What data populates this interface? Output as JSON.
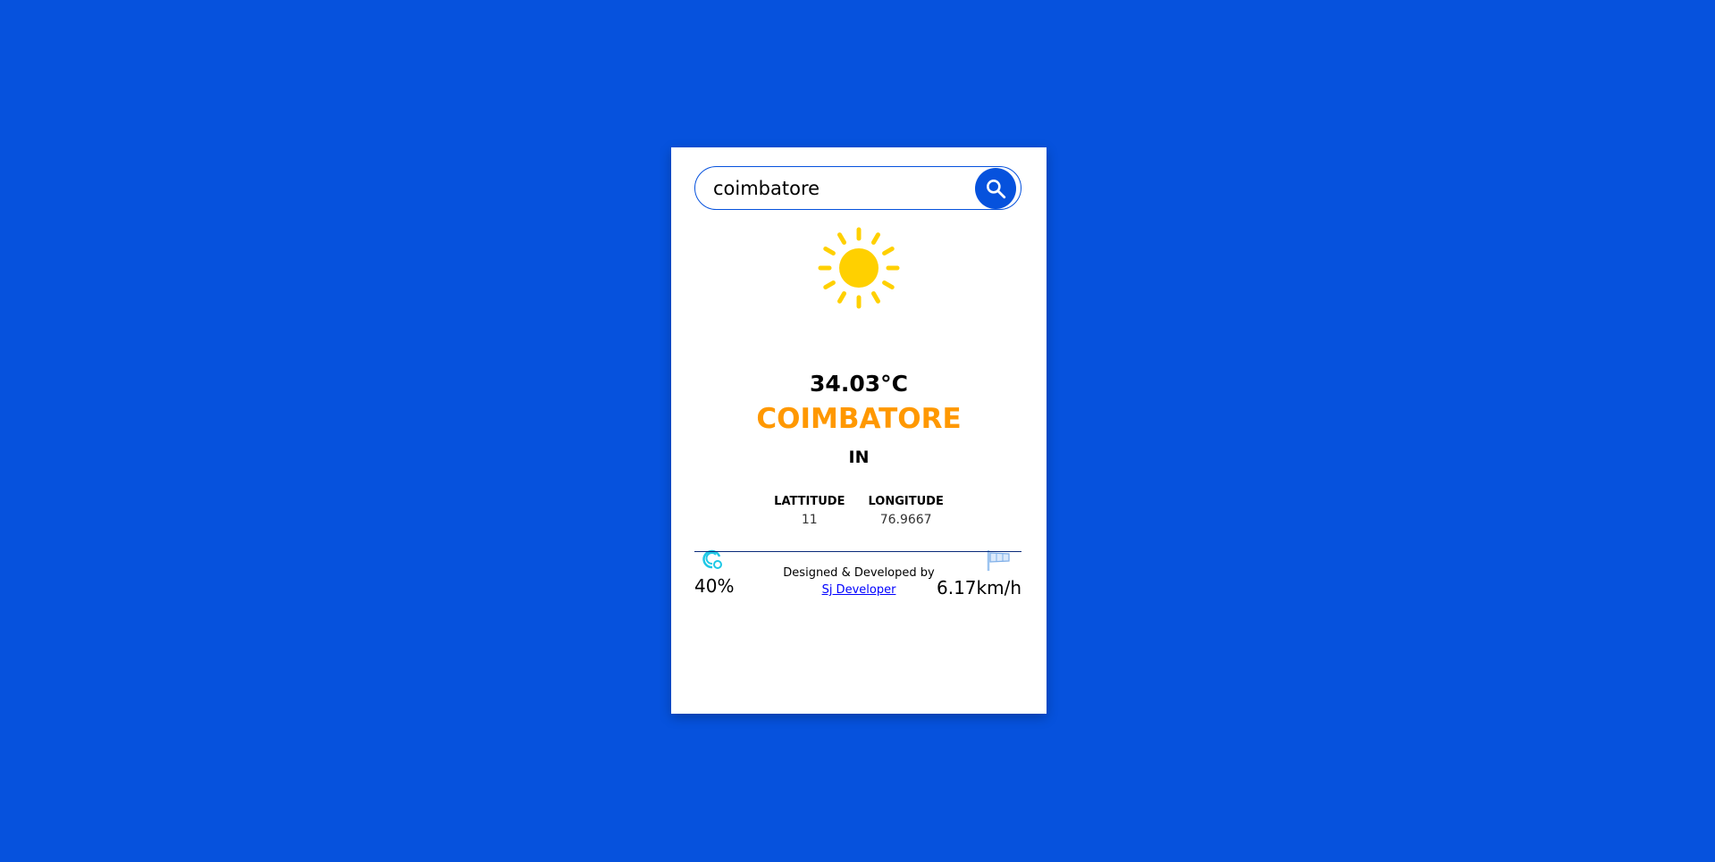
{
  "search": {
    "value": "coimbatore",
    "button_icon": "search-icon"
  },
  "weather": {
    "icon": "sun-icon",
    "temperature": "34.03°C",
    "city": "COIMBATORE",
    "country": "IN"
  },
  "coords": {
    "lat_label": "LATTITUDE",
    "lat_value": "11",
    "lon_label": "LONGITUDE",
    "lon_value": "76.9667"
  },
  "stats": {
    "humidity": "40%",
    "wind": "6.17km/h"
  },
  "footer": {
    "text": "Designed & Developed by",
    "link": "Sj Developer"
  },
  "colors": {
    "background": "#0652dd",
    "accent": "#ff9800",
    "sun": "#ffd000"
  }
}
